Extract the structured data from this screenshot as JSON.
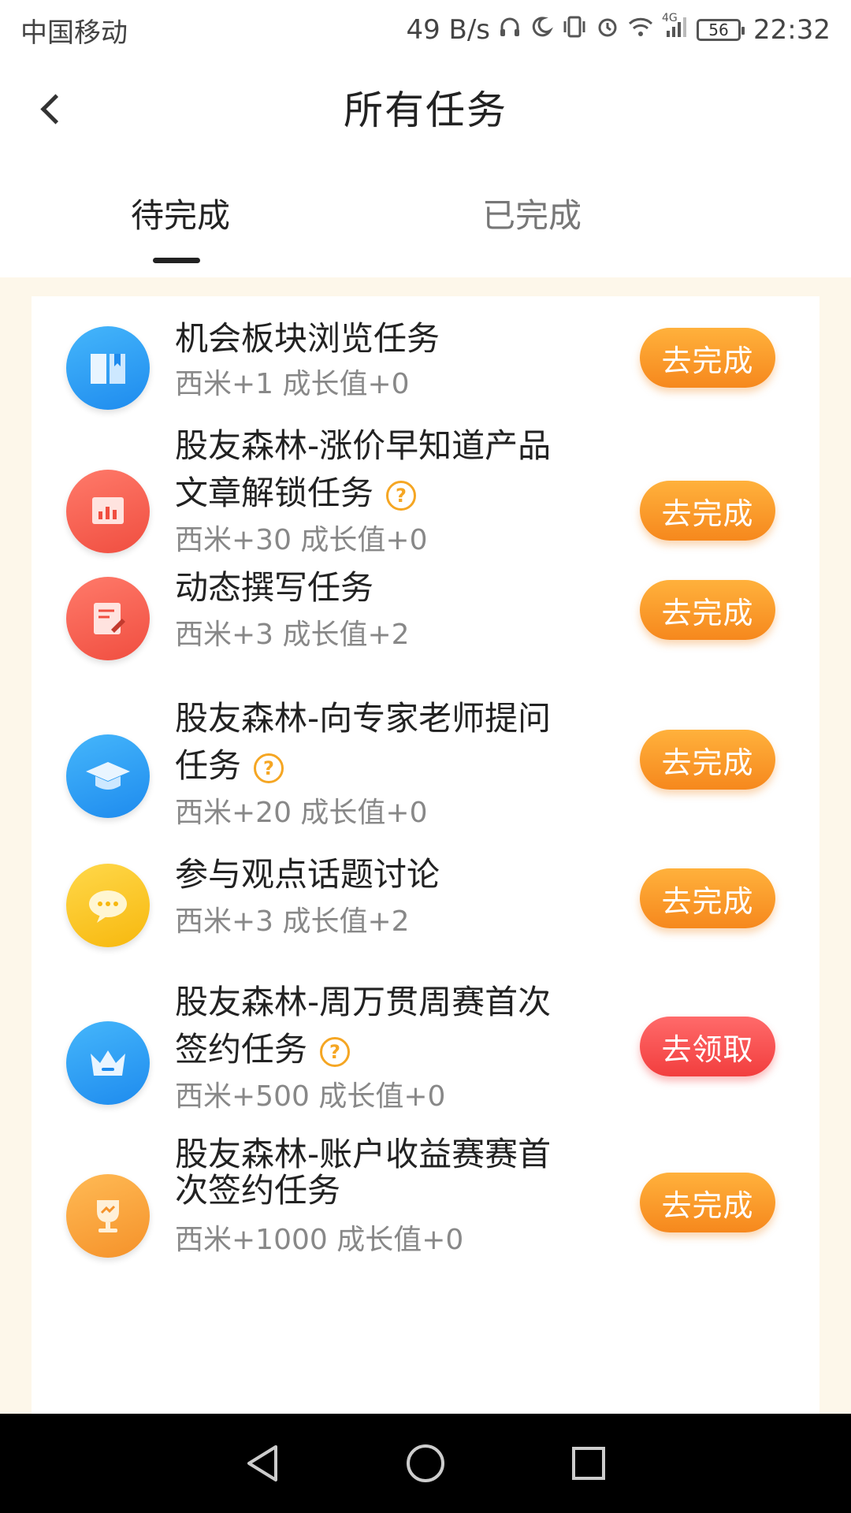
{
  "status_bar": {
    "carrier": "中国移动",
    "net_speed": "49 B/s",
    "network_label": "4G",
    "battery": "56",
    "time": "22:32"
  },
  "header": {
    "title": "所有任务"
  },
  "tabs": [
    {
      "label": "待完成",
      "active": true
    },
    {
      "label": "已完成",
      "active": false
    }
  ],
  "tasks": [
    {
      "icon": "book-icon",
      "color": "#2196f3",
      "title": "机会板块浏览任务",
      "reward": "西米+1 成长值+0",
      "help": false,
      "button": "去完成",
      "button_color": "#f6881d"
    },
    {
      "icon": "bar-chart-icon",
      "color": "#f04e40",
      "title": "股友森林-涨价早知道产品文章解锁任务",
      "reward": "西米+30 成长值+0",
      "help": true,
      "button": "去完成",
      "button_color": "#f6881d"
    },
    {
      "icon": "edit-note-icon",
      "color": "#f04e40",
      "title": "动态撰写任务",
      "reward": "西米+3 成长值+2",
      "help": false,
      "button": "去完成",
      "button_color": "#f6881d"
    },
    {
      "icon": "graduation-cap-icon",
      "color": "#2196f3",
      "title": "股友森林-向专家老师提问任务",
      "reward": "西米+20 成长值+0",
      "help": true,
      "button": "去完成",
      "button_color": "#f6881d"
    },
    {
      "icon": "chat-bubble-icon",
      "color": "#f7b80e",
      "title": "参与观点话题讨论",
      "reward": "西米+3 成长值+2",
      "help": false,
      "button": "去完成",
      "button_color": "#f6881d"
    },
    {
      "icon": "crown-icon",
      "color": "#2196f3",
      "title": "股友森林-周万贯周赛首次签约任务",
      "reward": "西米+500 成长值+0",
      "help": true,
      "button": "去领取",
      "button_color": "#f23e3e"
    },
    {
      "icon": "trophy-icon",
      "color": "#f5922a",
      "title": "股友森林-账户收益赛赛首次签约任务",
      "reward": "西米+1000 成长值+0",
      "help": false,
      "button": "去完成",
      "button_color": "#f6881d"
    }
  ],
  "help_glyph": "?"
}
